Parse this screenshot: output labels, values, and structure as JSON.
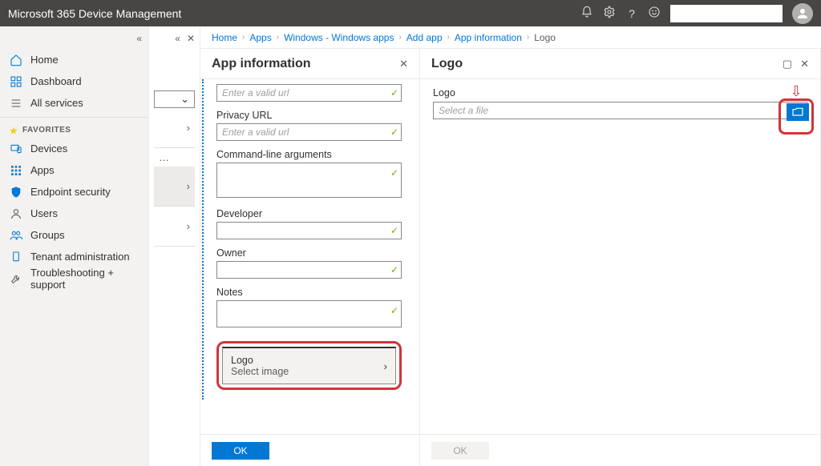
{
  "topbar": {
    "title": "Microsoft 365 Device Management"
  },
  "nav": {
    "home": "Home",
    "dashboard": "Dashboard",
    "all_services": "All services",
    "favorites_header": "FAVORITES",
    "devices": "Devices",
    "apps": "Apps",
    "endpoint_security": "Endpoint security",
    "users": "Users",
    "groups": "Groups",
    "tenant_admin": "Tenant administration",
    "troubleshoot": "Troubleshooting + support"
  },
  "crumbs": {
    "home": "Home",
    "apps": "Apps",
    "windows": "Windows - Windows apps",
    "add_app": "Add app",
    "app_info": "App information",
    "current": "Logo"
  },
  "app_info": {
    "title": "App information",
    "url_placeholder": "Enter a valid url",
    "privacy_url_label": "Privacy URL",
    "privacy_url_placeholder": "Enter a valid url",
    "cmd_label": "Command-line arguments",
    "developer_label": "Developer",
    "owner_label": "Owner",
    "notes_label": "Notes",
    "logo_row_label": "Logo",
    "logo_row_sub": "Select image",
    "ok": "OK"
  },
  "logo": {
    "title": "Logo",
    "field_label": "Logo",
    "file_placeholder": "Select a file",
    "ok": "OK"
  }
}
